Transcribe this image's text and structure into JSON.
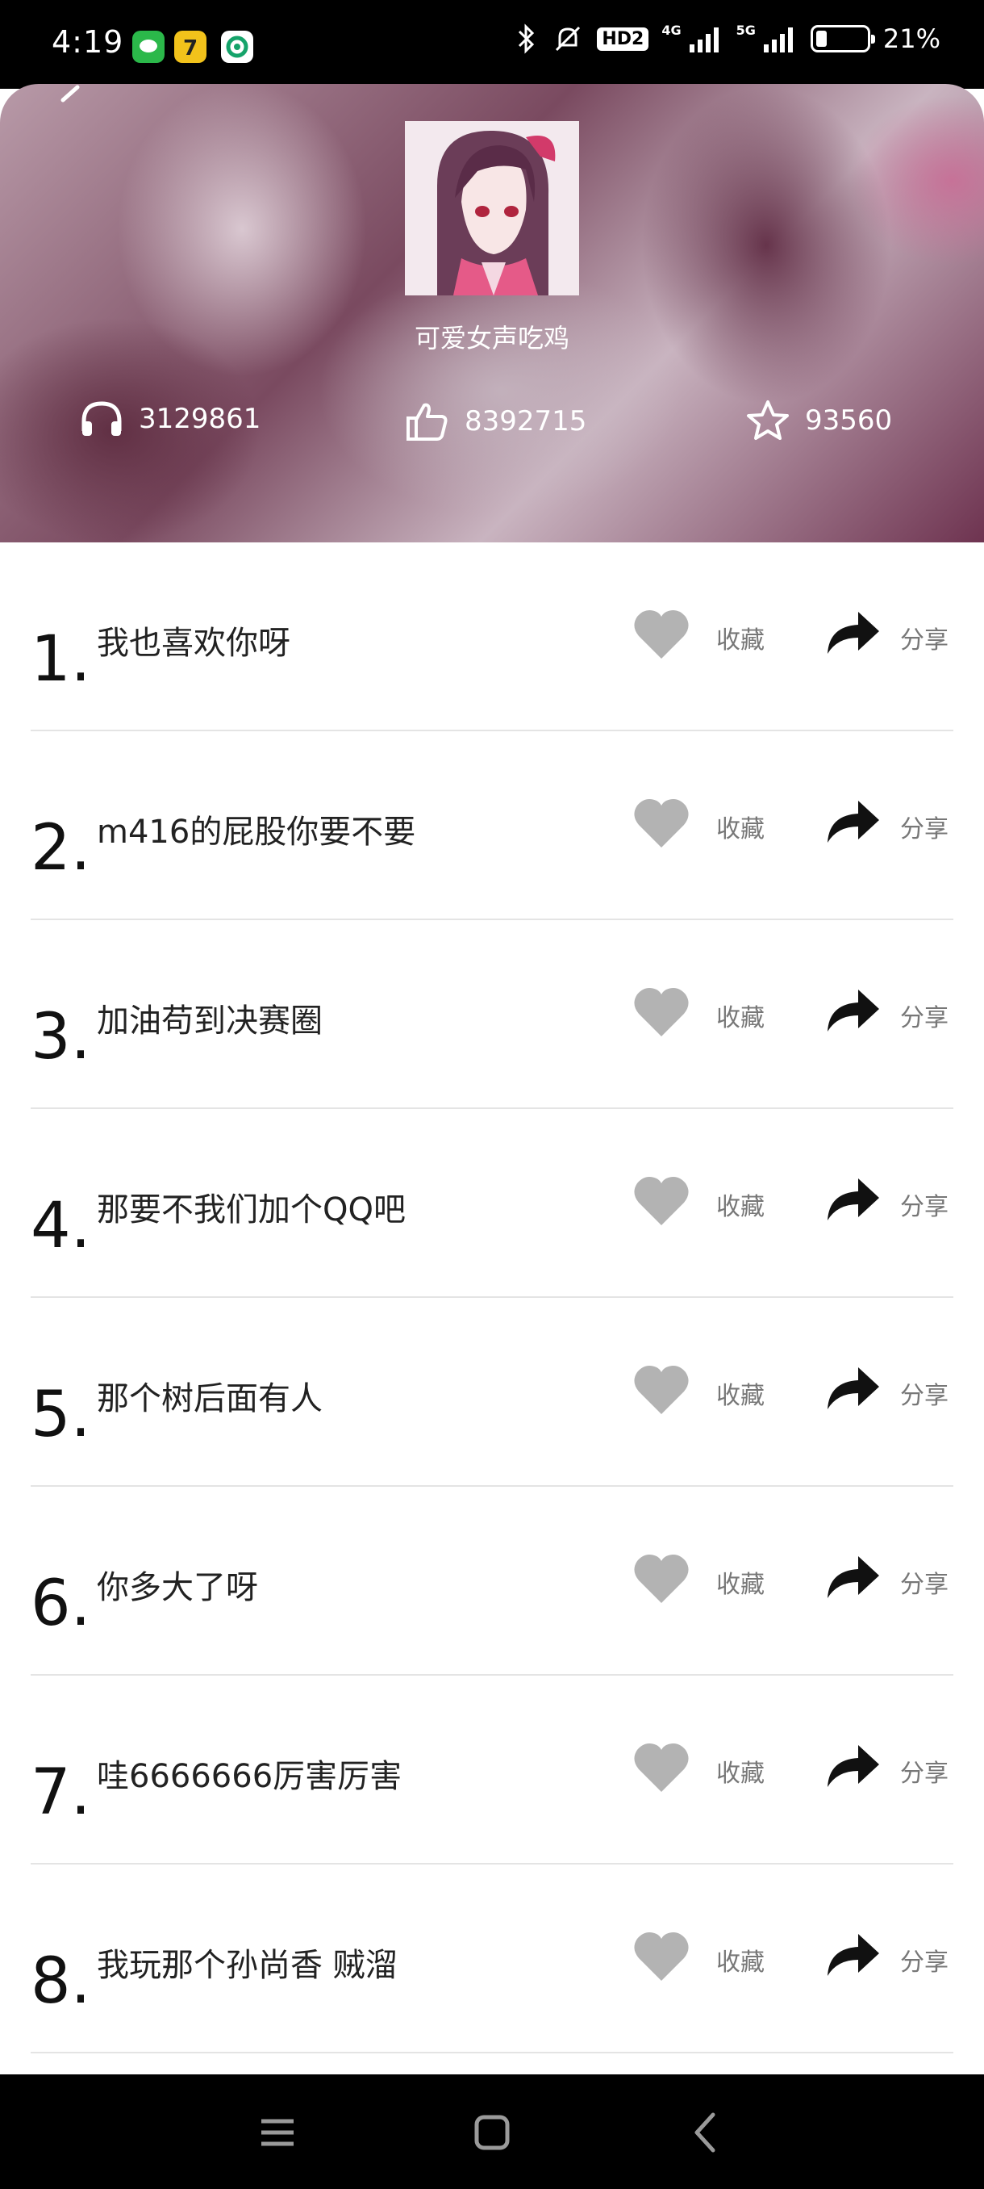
{
  "status_bar": {
    "time": "4:19",
    "hd_label": "HD2",
    "net1": "4G",
    "net2": "5G",
    "battery_percent": "21%",
    "battery_level": 0.21,
    "app_icons": [
      {
        "name": "message-app-icon",
        "color": "#2bb84a"
      },
      {
        "name": "seven-app-icon",
        "color": "#f2c21b"
      },
      {
        "name": "swirl-app-icon",
        "color": "#15a36a"
      }
    ]
  },
  "header": {
    "title": "可爱女声吃鸡",
    "stats": {
      "listens": "3129861",
      "likes": "8392715",
      "stars": "93560"
    }
  },
  "list": {
    "items": [
      {
        "index": "1.",
        "title": "我也喜欢你呀",
        "fav_label": "收藏",
        "share_label": "分享"
      },
      {
        "index": "2.",
        "title": "m416的屁股你要不要",
        "fav_label": "收藏",
        "share_label": "分享"
      },
      {
        "index": "3.",
        "title": "加油苟到决赛圈",
        "fav_label": "收藏",
        "share_label": "分享"
      },
      {
        "index": "4.",
        "title": "那要不我们加个QQ吧",
        "fav_label": "收藏",
        "share_label": "分享"
      },
      {
        "index": "5.",
        "title": "那个树后面有人",
        "fav_label": "收藏",
        "share_label": "分享"
      },
      {
        "index": "6.",
        "title": "你多大了呀",
        "fav_label": "收藏",
        "share_label": "分享"
      },
      {
        "index": "7.",
        "title": "哇6666666厉害厉害",
        "fav_label": "收藏",
        "share_label": "分享"
      },
      {
        "index": "8.",
        "title": "我玩那个孙尚香 贼溜",
        "fav_label": "收藏",
        "share_label": "分享"
      }
    ]
  },
  "colors": {
    "fav_icon": "#b3b3b3",
    "share_icon": "#111111",
    "label": "#777777"
  }
}
